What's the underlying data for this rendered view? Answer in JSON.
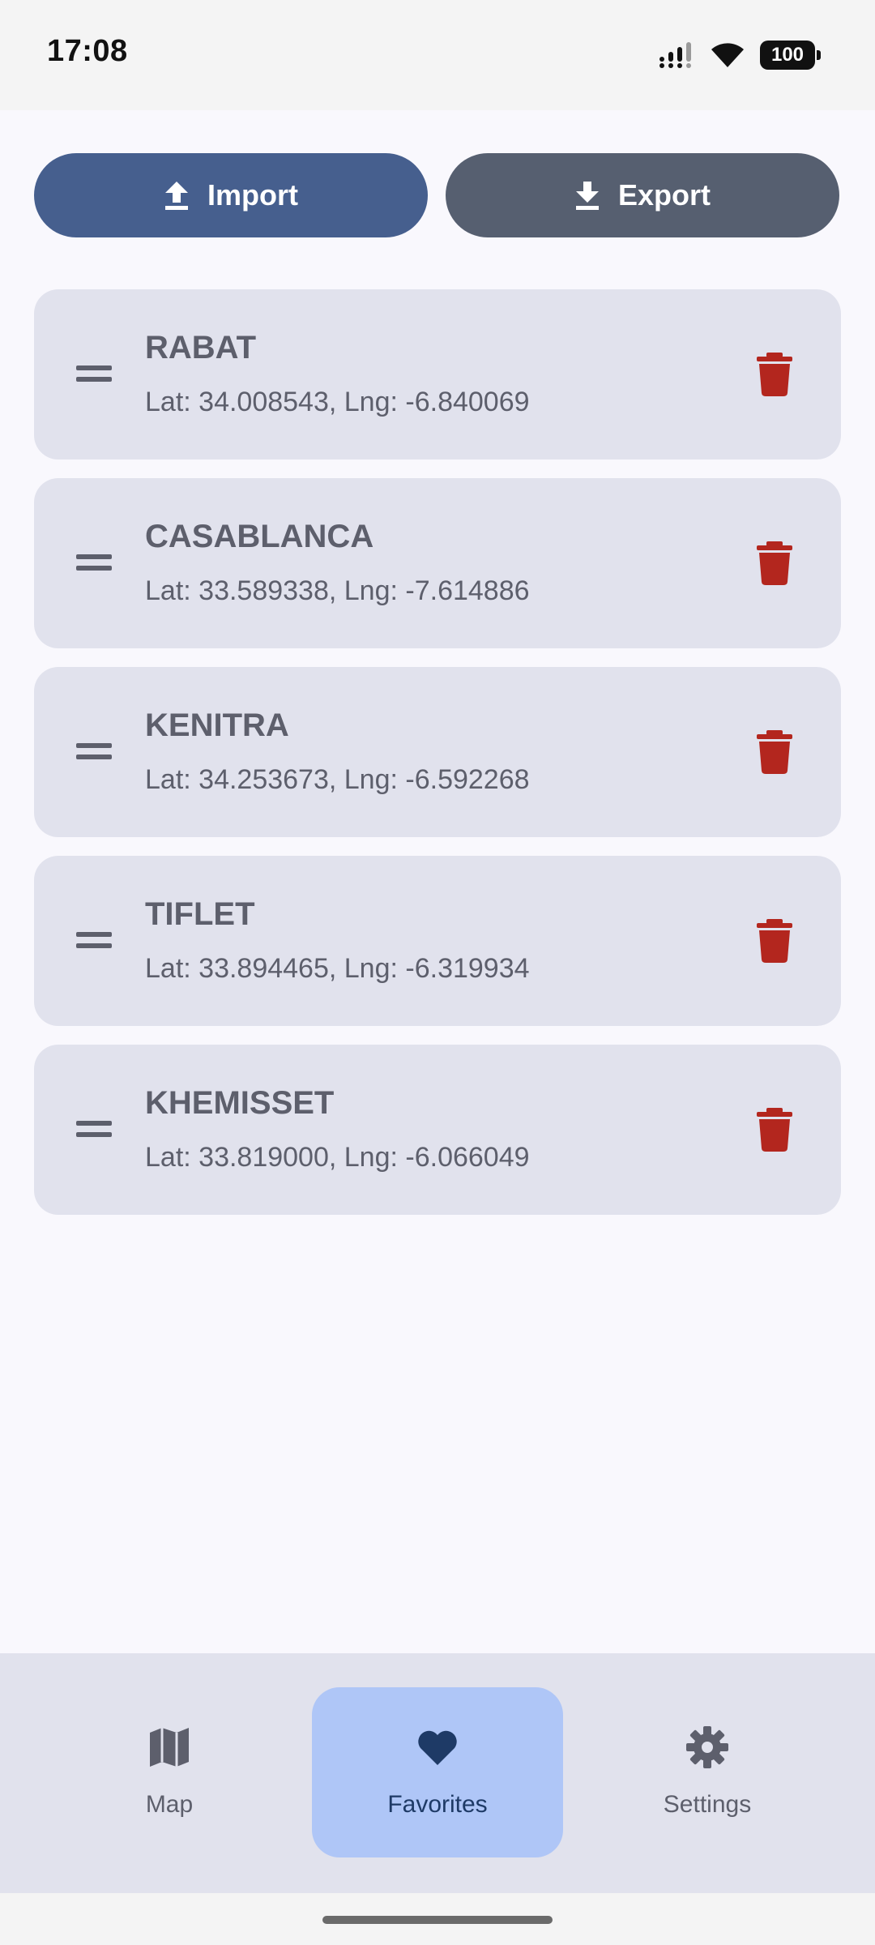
{
  "status_bar": {
    "time": "17:08",
    "battery": "100",
    "icons": [
      "signal-icon",
      "wifi-icon",
      "battery-icon"
    ]
  },
  "actions": {
    "import_label": "Import",
    "export_label": "Export",
    "import_icon": "upload-icon",
    "export_icon": "download-icon",
    "import_color": "#465f8e",
    "export_color": "#565f70"
  },
  "favorites": [
    {
      "name": "RABAT",
      "coords": "Lat: 34.008543, Lng: -6.840069"
    },
    {
      "name": "CASABLANCA",
      "coords": "Lat: 33.589338, Lng: -7.614886"
    },
    {
      "name": "KENITRA",
      "coords": "Lat: 34.253673, Lng: -6.592268"
    },
    {
      "name": "TIFLET",
      "coords": "Lat: 33.894465, Lng: -6.319934"
    },
    {
      "name": "KHEMISSET",
      "coords": "Lat: 33.819000, Lng: -6.066049"
    }
  ],
  "item_icons": {
    "drag": "drag-handle-icon",
    "delete": "trash-icon"
  },
  "colors": {
    "card_bg": "#e1e2ed",
    "delete": "#b3261e",
    "nav_active": "#afc6f7",
    "background": "#f9f8fd"
  },
  "nav": {
    "map_label": "Map",
    "favorites_label": "Favorites",
    "settings_label": "Settings",
    "active": "Favorites",
    "map_icon": "map-icon",
    "favorites_icon": "heart-icon",
    "settings_icon": "gear-icon"
  }
}
